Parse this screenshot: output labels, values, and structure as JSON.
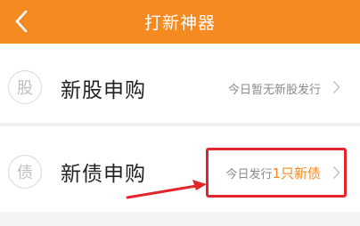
{
  "header": {
    "title": "打新神器",
    "back_icon": "chevron-left-icon",
    "background": "#f58a23"
  },
  "rows": [
    {
      "icon_char": "股",
      "title": "新股申购",
      "status": "今日暂无新股发行"
    },
    {
      "icon_char": "债",
      "title": "新债申购",
      "status_prefix": "今日发行",
      "status_highlight": "1只新债"
    }
  ],
  "colors": {
    "accent": "#f58a23",
    "annotation": "#e3262d"
  }
}
